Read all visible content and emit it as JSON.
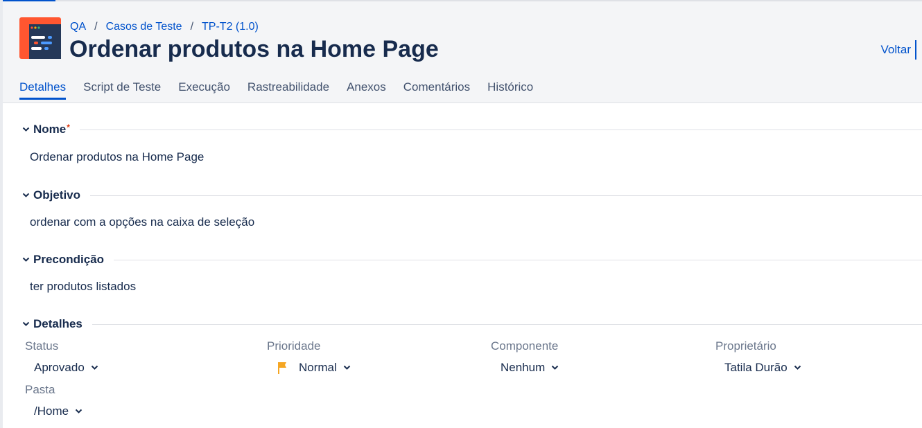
{
  "breadcrumb": {
    "items": [
      "QA",
      "Casos de Teste",
      "TP-T2 (1.0)"
    ],
    "separator": "/"
  },
  "page": {
    "title": "Ordenar produtos na Home Page",
    "back_label": "Voltar"
  },
  "tabs": [
    {
      "label": "Detalhes",
      "active": true
    },
    {
      "label": "Script de Teste"
    },
    {
      "label": "Execução"
    },
    {
      "label": "Rastreabilidade"
    },
    {
      "label": "Anexos"
    },
    {
      "label": "Comentários"
    },
    {
      "label": "Histórico"
    }
  ],
  "sections": {
    "nome": {
      "label": "Nome",
      "required_mark": "*",
      "value": "Ordenar produtos na Home Page"
    },
    "objetivo": {
      "label": "Objetivo",
      "value": "ordenar com a opções na caixa de seleção"
    },
    "precondicao": {
      "label": "Precondição",
      "value": "ter produtos listados"
    },
    "detalhes": {
      "label": "Detalhes"
    }
  },
  "details": {
    "status": {
      "label": "Status",
      "value": "Aprovado"
    },
    "prioridade": {
      "label": "Prioridade",
      "value": "Normal",
      "icon": "flag-icon",
      "icon_color": "#f5a623"
    },
    "componente": {
      "label": "Componente",
      "value": "Nenhum"
    },
    "proprietario": {
      "label": "Proprietário",
      "value": "Tatila Durão"
    },
    "pasta": {
      "label": "Pasta",
      "value": "/Home"
    }
  },
  "colors": {
    "accent": "#0052cc",
    "text": "#172b4d",
    "muted": "#6b778c",
    "header_bg": "#f4f5f7",
    "logo_bg": "#ff5630",
    "logo_panel": "#253858"
  }
}
